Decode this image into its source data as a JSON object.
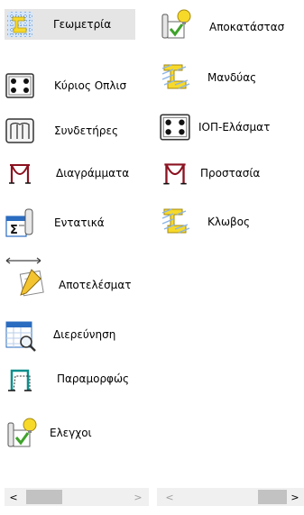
{
  "left_panel": {
    "items": [
      {
        "label": "Γεωμετρία",
        "icon": "geometry-icon",
        "selected": true
      },
      {
        "label": "Κύριος Οπλισ",
        "icon": "main-reinforcement-icon"
      },
      {
        "label": "Συνδετήρες",
        "icon": "stirrups-icon"
      },
      {
        "label": "Διαγράμματα",
        "icon": "diagrams-icon"
      },
      {
        "label": "Εντατικά",
        "icon": "internal-forces-icon"
      },
      {
        "label": "Αποτελέσματ",
        "icon": "results-icon"
      },
      {
        "label": "Διερεύνηση",
        "icon": "investigation-icon"
      },
      {
        "label": "Παραμορφώς",
        "icon": "deformation-icon"
      },
      {
        "label": "Ελεγχοι",
        "icon": "checks-icon"
      }
    ]
  },
  "right_panel": {
    "items": [
      {
        "label": "Αποκατάστασ",
        "icon": "restoration-icon"
      },
      {
        "label": "Μανδύας",
        "icon": "jacket-icon"
      },
      {
        "label": "ΙΟΠ-Ελάσματ",
        "icon": "frp-plates-icon"
      },
      {
        "label": "Προστασία",
        "icon": "protection-icon"
      },
      {
        "label": "Κλωβος",
        "icon": "cage-icon"
      }
    ]
  },
  "scrollbars": {
    "left": {
      "left_arrow": "<",
      "right_arrow": ">"
    },
    "right": {
      "left_arrow": "<",
      "right_arrow": ">"
    }
  },
  "colors": {
    "selected_bg": "#e5e5e5",
    "yellow_accent": "#f7d92a",
    "check_green": "#3fa32a",
    "frame_red": "#8b1220",
    "frame_teal": "#0e8f8c",
    "grid_blue": "#2a6cc0"
  }
}
